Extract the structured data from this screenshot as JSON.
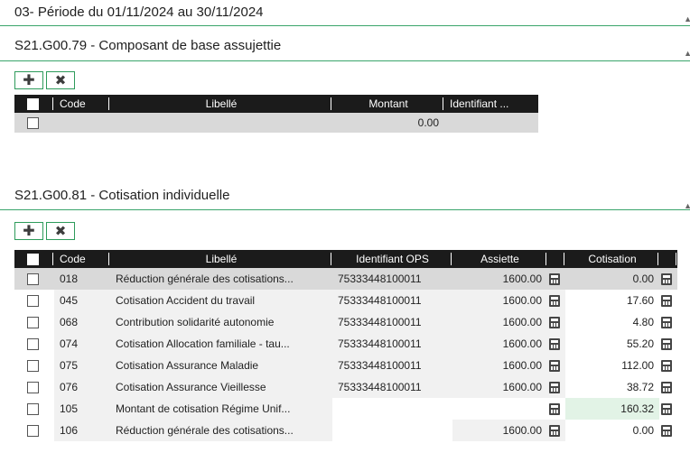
{
  "period": {
    "title": "03- Période du 01/11/2024 au 30/11/2024"
  },
  "section1": {
    "title": "S21.G00.79 - Composant de base assujettie",
    "add_icon": "plus-icon",
    "delete_icon": "cross-icon",
    "columns": [
      "Code",
      "Libellé",
      "Montant",
      "Identifiant ..."
    ],
    "rows": [
      {
        "code": "",
        "libelle": "",
        "montant": "0.00",
        "identifiant": ""
      }
    ]
  },
  "section2": {
    "title": "S21.G00.81 - Cotisation individuelle",
    "add_icon": "plus-icon",
    "delete_icon": "cross-icon",
    "columns": [
      "Code",
      "Libellé",
      "Identifiant OPS",
      "Assiette",
      "",
      "Cotisation",
      ""
    ],
    "rows": [
      {
        "code": "018",
        "libelle": "Réduction générale des cotisations...",
        "ops": "75333448100011",
        "assiette": "1600.00",
        "cotisation": "0.00"
      },
      {
        "code": "045",
        "libelle": "Cotisation Accident du travail",
        "ops": "75333448100011",
        "assiette": "1600.00",
        "cotisation": "17.60"
      },
      {
        "code": "068",
        "libelle": "Contribution solidarité autonomie",
        "ops": "75333448100011",
        "assiette": "1600.00",
        "cotisation": "4.80"
      },
      {
        "code": "074",
        "libelle": "Cotisation Allocation familiale - tau...",
        "ops": "75333448100011",
        "assiette": "1600.00",
        "cotisation": "55.20"
      },
      {
        "code": "075",
        "libelle": "Cotisation Assurance Maladie",
        "ops": "75333448100011",
        "assiette": "1600.00",
        "cotisation": "112.00"
      },
      {
        "code": "076",
        "libelle": "Cotisation Assurance Vieillesse",
        "ops": "75333448100011",
        "assiette": "1600.00",
        "cotisation": "38.72"
      },
      {
        "code": "105",
        "libelle": "Montant de cotisation Régime Unif...",
        "ops": "",
        "assiette": "",
        "cotisation": "160.32"
      },
      {
        "code": "106",
        "libelle": "Réduction générale des cotisations...",
        "ops": "",
        "assiette": "1600.00",
        "cotisation": "0.00"
      }
    ]
  },
  "colors": {
    "accent": "#3aa56b",
    "header_bg": "#1b1b1b",
    "selected_row": "#d9d9d9",
    "highlight_cell": "#e2f3e6"
  }
}
